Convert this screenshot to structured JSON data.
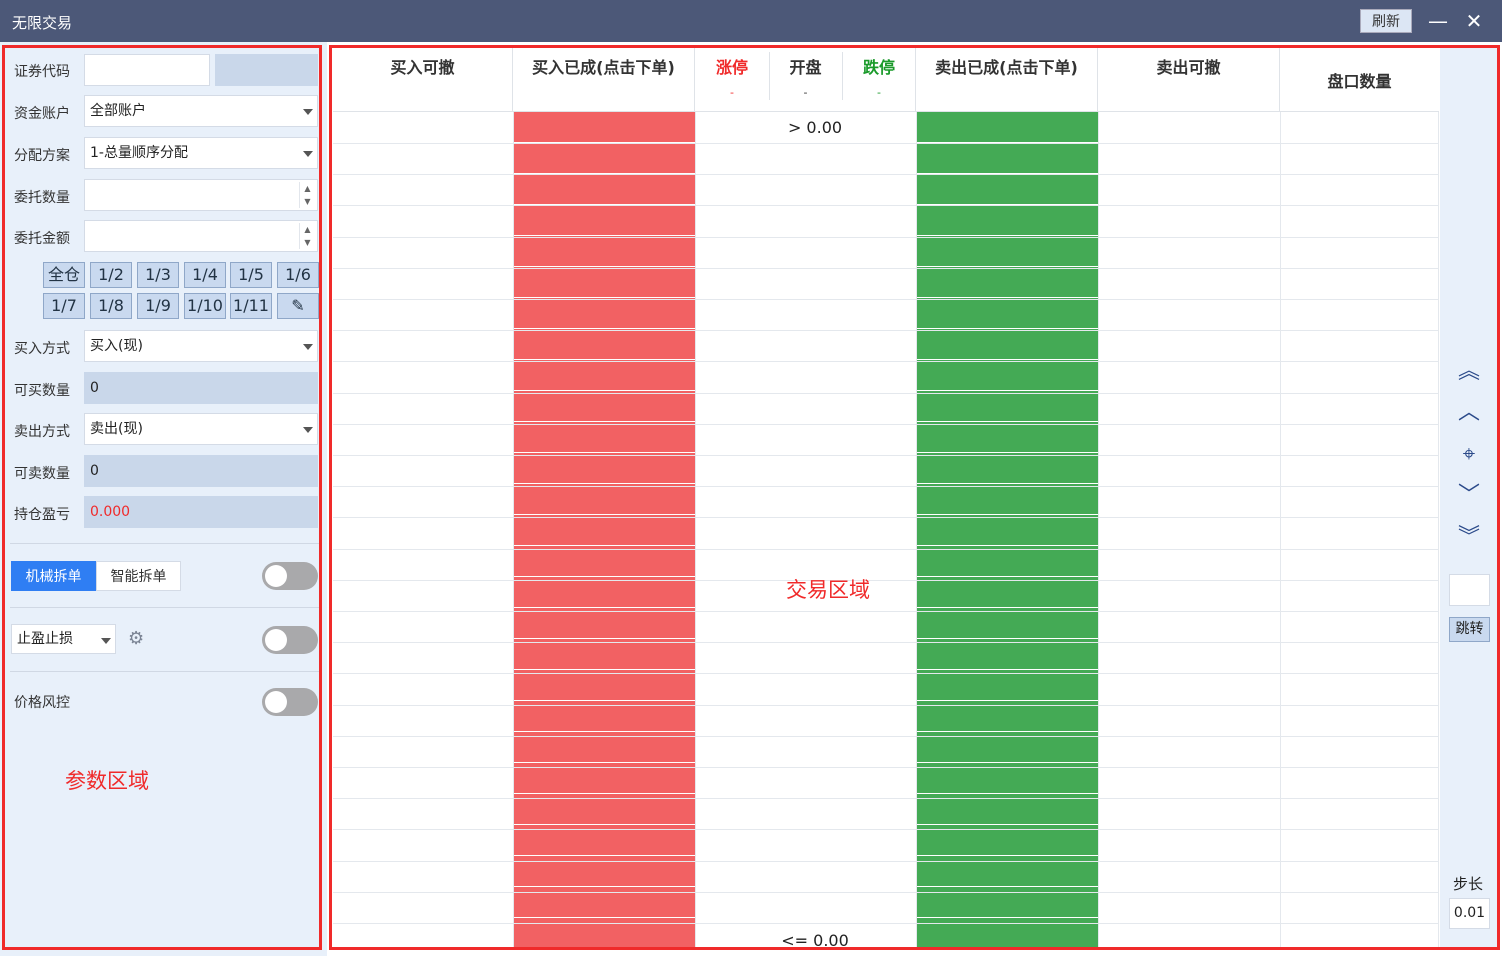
{
  "window": {
    "title": "无限交易",
    "refresh_label": "刷新",
    "minimize": "—",
    "close": "✕"
  },
  "params": {
    "security_code_label": "证券代码",
    "account_label": "资金账户",
    "account_value": "全部账户",
    "alloc_label": "分配方案",
    "alloc_value": "1-总量顺序分配",
    "qty_label": "委托数量",
    "amount_label": "委托金额",
    "fractions": [
      "全仓",
      "1/2",
      "1/3",
      "1/4",
      "1/5",
      "1/6",
      "1/7",
      "1/8",
      "1/9",
      "1/10",
      "1/11"
    ],
    "buy_mode_label": "买入方式",
    "buy_mode_value": "买入(现)",
    "buyable_label": "可买数量",
    "buyable_value": "0",
    "sell_mode_label": "卖出方式",
    "sell_mode_value": "卖出(现)",
    "sellable_label": "可卖数量",
    "sellable_value": "0",
    "pnl_label": "持仓盈亏",
    "pnl_value": "0.000",
    "split_mech": "机械拆单",
    "split_smart": "智能拆单",
    "tpsl_value": "止盈止损",
    "price_risk_label": "价格风控",
    "area_label": "参数区域"
  },
  "ladder": {
    "headers": {
      "buy_cancel": "买入可撤",
      "buy_filled": "买入已成(点击下单)",
      "limit_up": "涨停",
      "open": "开盘",
      "limit_down": "跌停",
      "dash": "-",
      "sell_filled": "卖出已成(点击下单)",
      "sell_cancel": "卖出可撤",
      "book_qty": "盘口数量"
    },
    "top_price": "> 0.00",
    "bottom_price": "<= 0.00",
    "area_label": "交易区域",
    "colors": {
      "buy": "#f26163",
      "sell": "#44aa55",
      "limit_up": "#f02a2a",
      "limit_down": "#1a9a2a"
    }
  },
  "side": {
    "icons": [
      "double-up-icon",
      "up-icon",
      "locate-icon",
      "down-icon",
      "double-down-icon"
    ],
    "jump_label": "跳转",
    "step_label": "步长",
    "step_value": "0.01"
  }
}
